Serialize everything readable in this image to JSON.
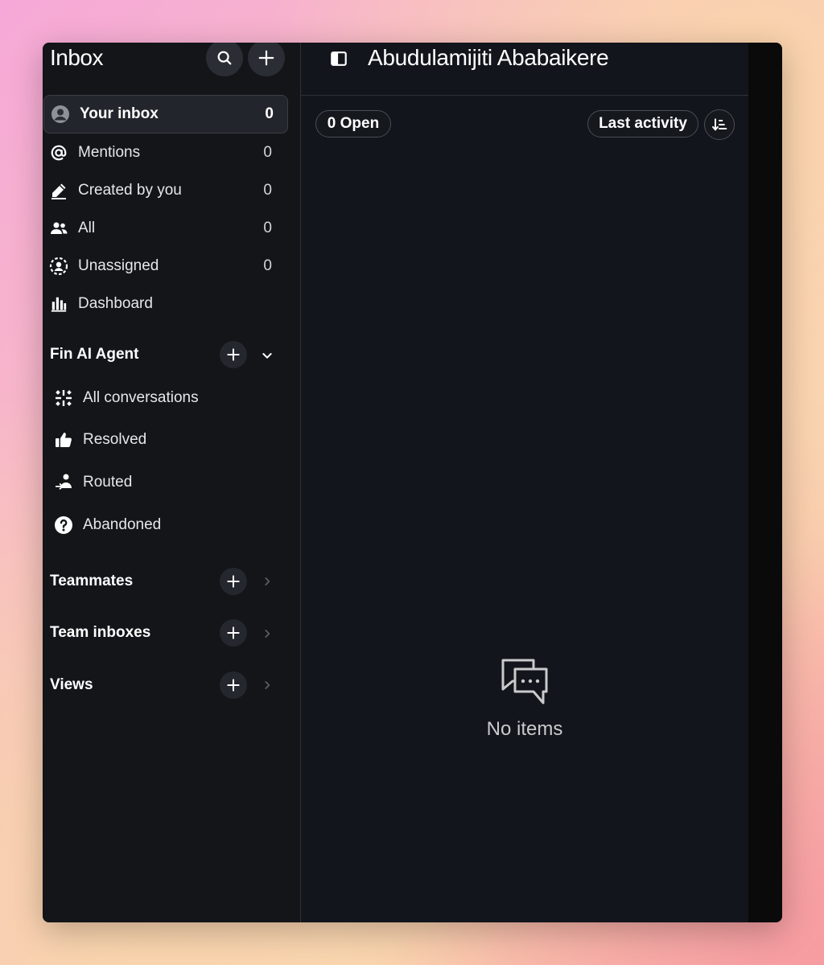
{
  "sidebar": {
    "title": "Inbox",
    "nav": [
      {
        "label": "Your inbox",
        "count": "0",
        "icon": "user-circle-icon"
      },
      {
        "label": "Mentions",
        "count": "0",
        "icon": "at-sign-icon"
      },
      {
        "label": "Created by you",
        "count": "0",
        "icon": "pen-icon"
      },
      {
        "label": "All",
        "count": "0",
        "icon": "users-icon"
      },
      {
        "label": "Unassigned",
        "count": "0",
        "icon": "unassigned-icon"
      },
      {
        "label": "Dashboard",
        "count": "",
        "icon": "bar-chart-icon"
      }
    ],
    "fin": {
      "title": "Fin AI Agent",
      "items": [
        {
          "label": "All conversations",
          "icon": "sparkle-icon"
        },
        {
          "label": "Resolved",
          "icon": "thumbs-up-icon"
        },
        {
          "label": "Routed",
          "icon": "route-person-icon"
        },
        {
          "label": "Abandoned",
          "icon": "question-circle-icon"
        }
      ]
    },
    "sections": [
      {
        "title": "Teammates"
      },
      {
        "title": "Team inboxes"
      },
      {
        "title": "Views"
      }
    ]
  },
  "main": {
    "title": "Abudulamijiti Ababaikere",
    "open_filter": "0 Open",
    "sort_label": "Last activity",
    "empty_text": "No items"
  }
}
